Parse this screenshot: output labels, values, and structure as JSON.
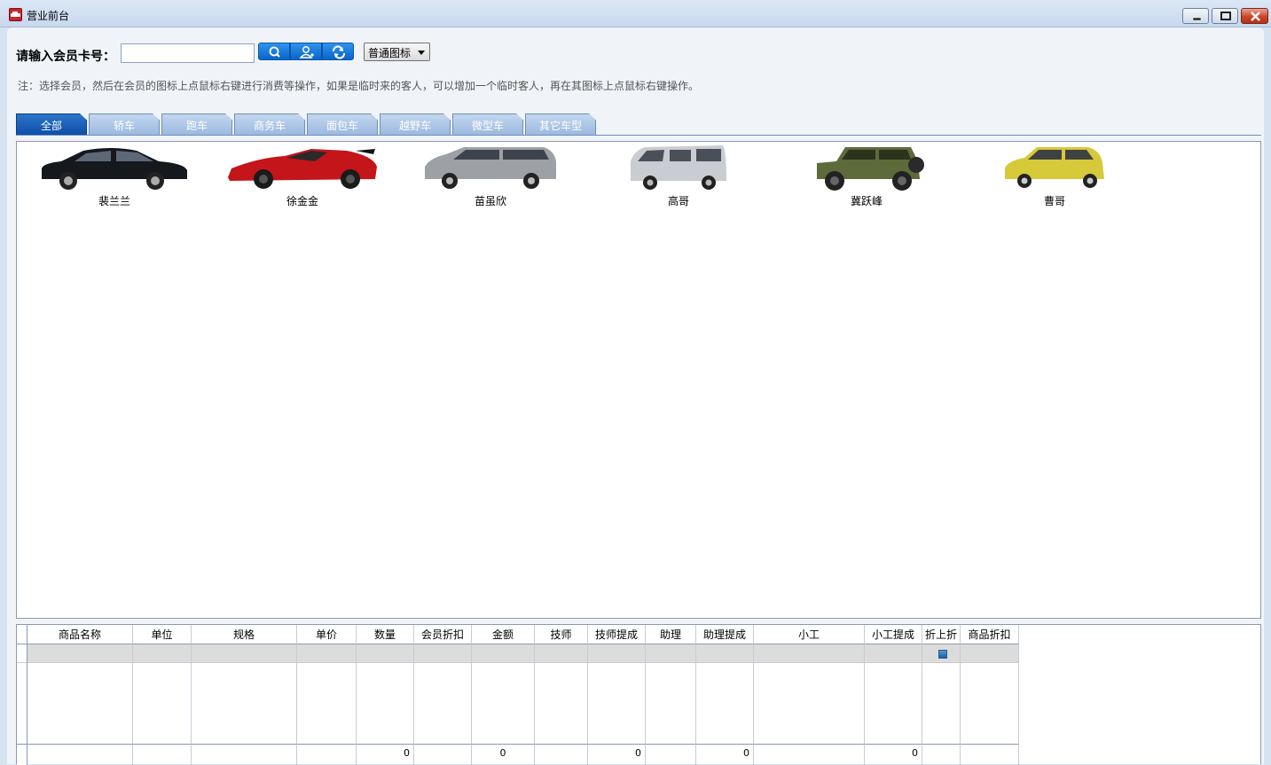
{
  "window": {
    "title": "营业前台",
    "minimize_icon": "minimize-icon",
    "maximize_icon": "maximize-icon",
    "close_icon": "close-icon"
  },
  "search": {
    "label": "请输入会员卡号：",
    "value": "",
    "placeholder": "",
    "buttons": [
      "search-icon",
      "user-icon",
      "refresh-icon"
    ],
    "view_mode": "普通图标"
  },
  "note": "注：选择会员，然后在会员的图标上点鼠标右键进行消费等操作，如果是临时来的客人，可以增加一个临时客人，再在其图标上点鼠标右键操作。",
  "tabs": [
    {
      "label": "全部",
      "active": true
    },
    {
      "label": "轿车",
      "active": false
    },
    {
      "label": "跑车",
      "active": false
    },
    {
      "label": "商务车",
      "active": false
    },
    {
      "label": "面包车",
      "active": false
    },
    {
      "label": "越野车",
      "active": false
    },
    {
      "label": "微型车",
      "active": false
    },
    {
      "label": "其它车型",
      "active": false
    }
  ],
  "members": [
    {
      "name": "裴兰兰",
      "car": "sedan",
      "color": "#15181d"
    },
    {
      "name": "徐金金",
      "car": "sports",
      "color": "#c3151a"
    },
    {
      "name": "苗虽欣",
      "car": "mpv",
      "color": "#9da1a6"
    },
    {
      "name": "高哥",
      "car": "van",
      "color": "#c9ccd0"
    },
    {
      "name": "冀跃峰",
      "car": "suv",
      "color": "#5d6a3a"
    },
    {
      "name": "曹哥",
      "car": "mini",
      "color": "#d6c93a"
    }
  ],
  "grid": {
    "columns": [
      "商品名称",
      "单位",
      "规格",
      "单价",
      "数量",
      "会员折扣",
      "金额",
      "技师",
      "技师提成",
      "助理",
      "助理提成",
      "小工",
      "小工提成",
      "折上折",
      "商品折扣"
    ],
    "first_row_checkbox": true,
    "totals": [
      "",
      "",
      "",
      "",
      "0",
      "",
      "0",
      "",
      "0",
      "",
      "0",
      "",
      "0",
      "",
      ""
    ],
    "accent": "#1d5fa8"
  }
}
